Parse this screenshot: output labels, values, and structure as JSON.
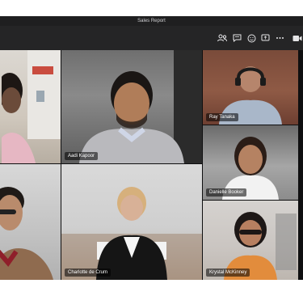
{
  "window": {
    "title": "Sales Report"
  },
  "toolbar": {
    "icons": [
      "participants-icon",
      "chat-icon",
      "reactions-icon",
      "share-icon",
      "more-icon",
      "camera-icon"
    ]
  },
  "participants": [
    {
      "name": ""
    },
    {
      "name": "Aadi Kapoor"
    },
    {
      "name": "Ray Tanaka"
    },
    {
      "name": "Danielle Booker"
    },
    {
      "name": ""
    },
    {
      "name": "Charlotte de Crum"
    },
    {
      "name": "Krystal McKinney"
    }
  ],
  "colors": {
    "app_bg": "#0f0f10",
    "titlebar_bg": "#1f1f20",
    "toolbar_bg": "#252526",
    "name_tag_bg": "rgba(0,0,0,0.55)"
  }
}
